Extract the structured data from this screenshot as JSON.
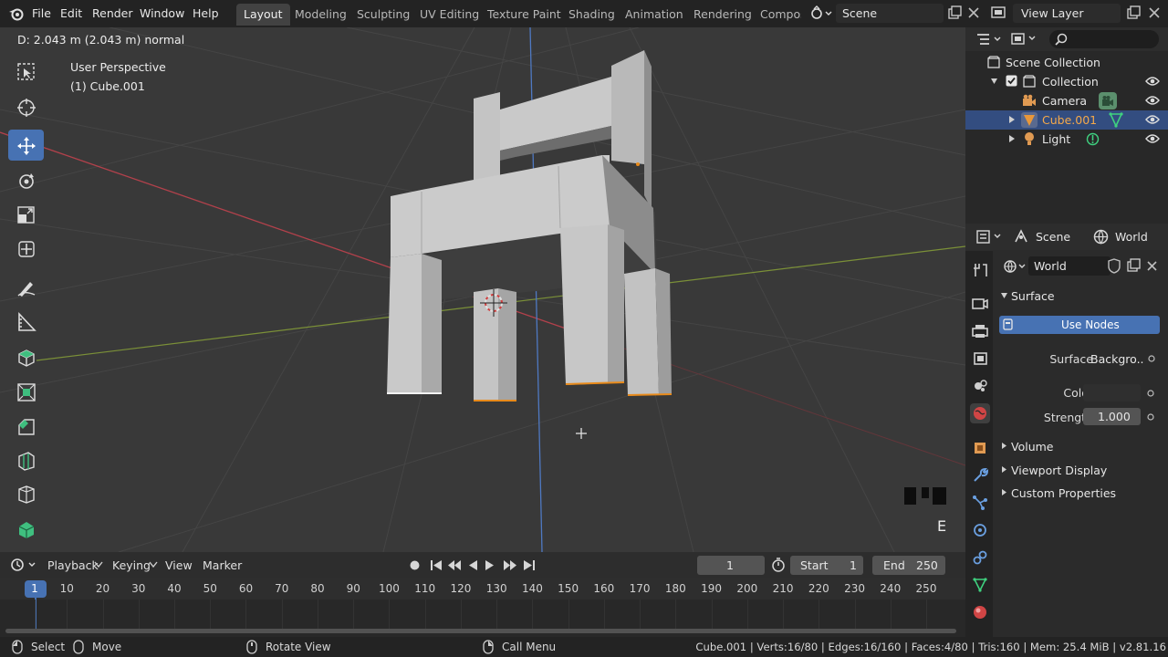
{
  "menu": {
    "items": [
      "File",
      "Edit",
      "Render",
      "Window",
      "Help"
    ]
  },
  "workspaces": {
    "tabs": [
      "Layout",
      "Modeling",
      "Sculpting",
      "UV Editing",
      "Texture Paint",
      "Shading",
      "Animation",
      "Rendering",
      "Compos"
    ],
    "active": "Layout"
  },
  "scene_field": {
    "value": "Scene"
  },
  "view_layer_field": {
    "value": "View Layer"
  },
  "viewport": {
    "operator_status": "D: 2.043 m (2.043 m) normal",
    "perspective": "User Perspective",
    "object_label": "(1) Cube.001",
    "key_hint": "E"
  },
  "timeline": {
    "menus": [
      "Playback",
      "Keying",
      "View",
      "Marker"
    ],
    "current_frame": "1",
    "start_label": "Start",
    "start_value": "1",
    "end_label": "End",
    "end_value": "250",
    "frame_ticks": [
      "1",
      "10",
      "20",
      "30",
      "40",
      "50",
      "60",
      "70",
      "80",
      "90",
      "100",
      "110",
      "120",
      "130",
      "140",
      "150",
      "160",
      "170",
      "180",
      "190",
      "200",
      "210",
      "220",
      "230",
      "240",
      "250"
    ]
  },
  "statusbar": {
    "select": "Select",
    "move": "Move",
    "rotate": "Rotate View",
    "call_menu": "Call Menu",
    "stats": "Cube.001 | Verts:16/80 | Edges:16/160 | Faces:4/80 | Tris:160 | Mem: 25.4 MiB | v2.81.16"
  },
  "outliner": {
    "rows": [
      {
        "label": "Scene Collection",
        "icon": "collection-icon"
      },
      {
        "label": "Collection",
        "icon": "collection-icon"
      },
      {
        "label": "Camera",
        "icon": "camera-icon"
      },
      {
        "label": "Cube.001",
        "icon": "mesh-icon",
        "selected": true
      },
      {
        "label": "Light",
        "icon": "light-icon"
      }
    ]
  },
  "properties": {
    "header_scene": "Scene",
    "header_world": "World",
    "world_name": "World",
    "panel_surface": "Surface",
    "use_nodes": "Use Nodes",
    "surface_label": "Surface",
    "surface_value": "Backgro..",
    "color_label": "Color",
    "strength_label": "Strength",
    "strength_value": "1.000",
    "collapsed_panels": [
      "Volume",
      "Viewport Display",
      "Custom Properties"
    ]
  },
  "colors": {
    "accent_blue": "#4772b3",
    "selected_row": "#334d80",
    "x_axis": "#c0444f",
    "y_axis": "#7d9a3a",
    "z_axis": "#4f79c2",
    "selection_orange": "#e88a1a"
  }
}
